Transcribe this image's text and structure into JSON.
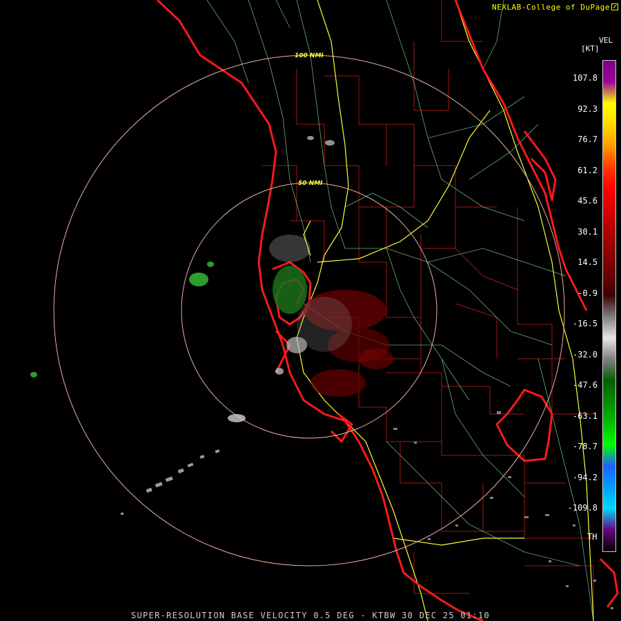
{
  "credit": "NEXLAB-College of DuPage",
  "footer": "SUPER-RESOLUTION BASE VELOCITY 0.5 DEG - KTBW 30 DEC 25 01:10",
  "range_rings": {
    "inner_label": "50 NMI",
    "outer_label": "100 NMI"
  },
  "scale": {
    "product": "VEL",
    "unit": "[KT]",
    "ticks": [
      "107.8",
      "92.3",
      "76.7",
      "61.2",
      "45.6",
      "30.1",
      "14.5",
      "-0.9",
      "-16.5",
      "-32.0",
      "-47.6",
      "-63.1",
      "-78.7",
      "-94.2",
      "-109.8"
    ],
    "threshold_label": "TH",
    "colors": [
      "#7f007f",
      "#a0009f",
      "#ffff00",
      "#ffd800",
      "#ff9b00",
      "#ff3b00",
      "#ff0000",
      "#d80000",
      "#b00000",
      "#8f0000",
      "#6a0000",
      "#3f0000",
      "#7f7f7f",
      "#e6e6e6",
      "#7f7f7f",
      "#005f00",
      "#008f00",
      "#00bf00",
      "#00ff00",
      "#2060ff",
      "#00a0ff",
      "#00d8ff",
      "#6a0080",
      "#000000"
    ]
  },
  "colors": {
    "coast": "#ff1a1a",
    "county": "#a01818",
    "highway": "#ffff33",
    "road": "#7fdc9b",
    "ring": "#f0b0a0"
  }
}
